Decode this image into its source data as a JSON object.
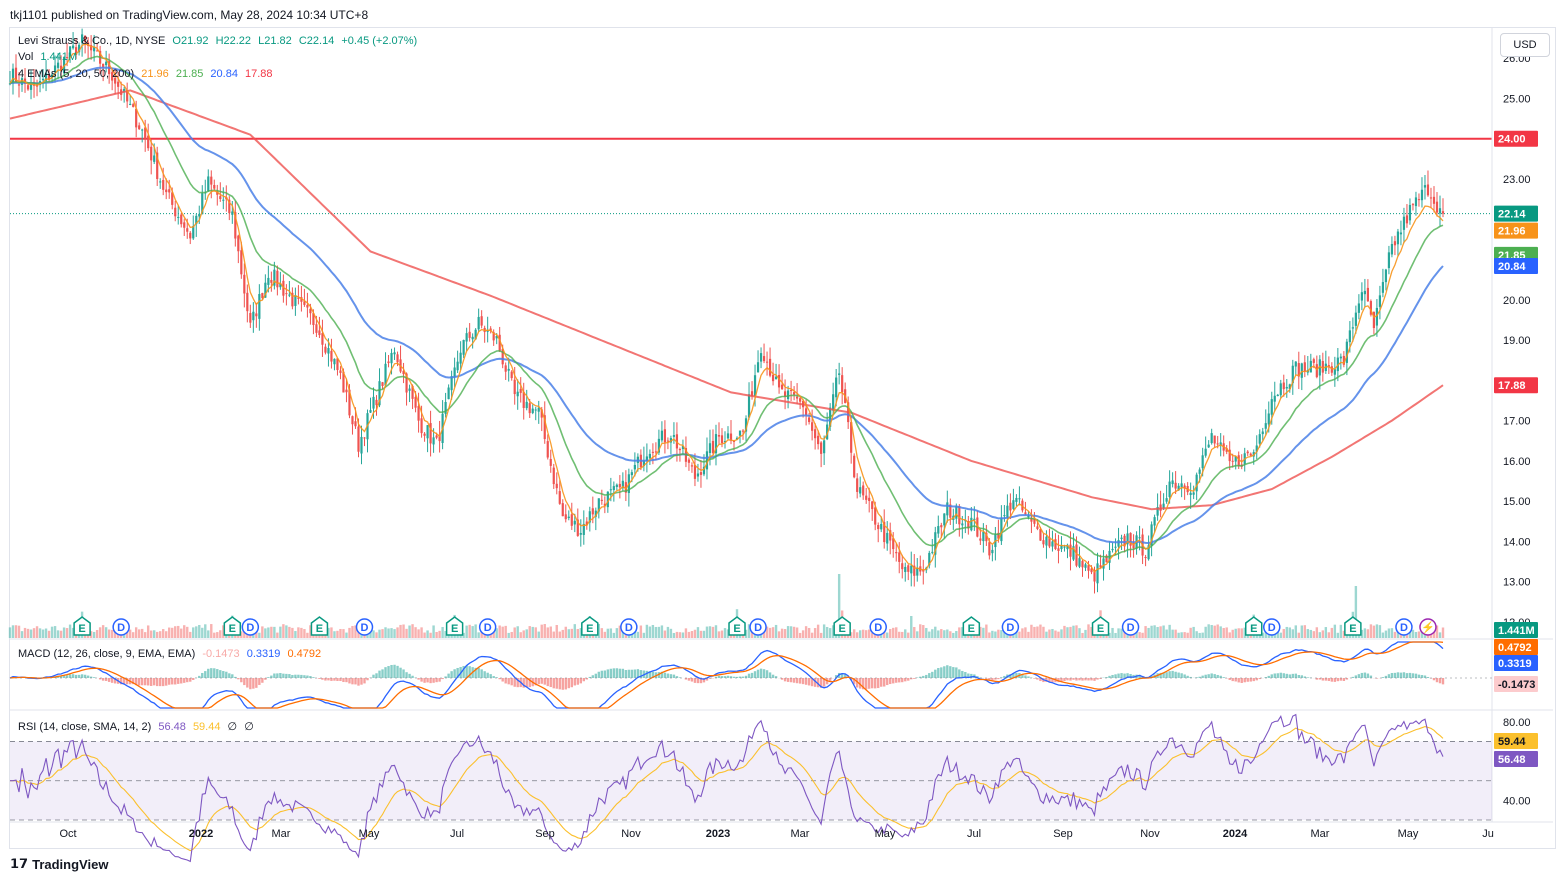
{
  "header": {
    "publisher": "tkj1101 published on TradingView.com, May 28, 2024 10:34 UTC+8"
  },
  "currency_button": "USD",
  "footer": {
    "brand": "TradingView"
  },
  "legend": {
    "symbol": "Levi Strauss & Co., 1D, NYSE",
    "ohlc": {
      "o": "O21.92",
      "h": "H22.22",
      "l": "L21.82",
      "c": "C22.14",
      "chg": "+0.45 (+2.07%)"
    },
    "vol_label": "Vol",
    "vol_value": "1.441M",
    "ema_label": "4 EMAs (5, 20, 50, 200)",
    "ema_values": [
      "21.96",
      "21.85",
      "20.84",
      "17.88"
    ],
    "macd_label": "MACD (12, 26, close, 9, EMA, EMA)",
    "macd_values": [
      "-0.1473",
      "0.3319",
      "0.4792"
    ],
    "rsi_label": "RSI (14, close, SMA, 14, 2)",
    "rsi_values": [
      "56.48",
      "59.44",
      "∅",
      "∅"
    ]
  },
  "colors": {
    "up": "#26a69a",
    "down": "#ef5350",
    "ema5": "#f7931a",
    "ema20": "#4caf50",
    "ema50": "#4a80e8",
    "ema200": "#ef5350",
    "hline": "#f23645",
    "macd": "#2962ff",
    "signal": "#ff6d00",
    "rsi": "#7e57c2",
    "rsi_ma": "#fbc02d"
  },
  "chart_data": [
    {
      "type": "candlestick",
      "title": "Levi Strauss & Co., 1D, NYSE",
      "ylim": [
        12.0,
        26.6
      ],
      "y_ticks": [
        "26.00",
        "25.00",
        "23.00",
        "20.00",
        "19.00",
        "17.00",
        "16.00",
        "15.00",
        "14.00",
        "13.00",
        "12.00"
      ],
      "x_ticks": [
        "Oct",
        "2022",
        "Mar",
        "May",
        "Jul",
        "Sep",
        "Nov",
        "2023",
        "Mar",
        "May",
        "Jul",
        "Sep",
        "Nov",
        "2024",
        "Mar",
        "May",
        "Ju"
      ],
      "horizontal_line": {
        "value": 24.0,
        "label": "24.00"
      },
      "last_price": 22.14,
      "price_labels": [
        {
          "label": "22.14",
          "value": 22.14,
          "color": "#089981"
        },
        {
          "label": "21.96",
          "value": 21.96,
          "color": "#f7931a"
        },
        {
          "label": "21.85",
          "value": 21.85,
          "color": "#4caf50"
        },
        {
          "label": "20.84",
          "value": 20.84,
          "color": "#2962ff"
        },
        {
          "label": "17.88",
          "value": 17.88,
          "color": "#f23645"
        }
      ],
      "close_series": [
        {
          "t": 0,
          "v": 25.6
        },
        {
          "t": 8,
          "v": 25.2
        },
        {
          "t": 16,
          "v": 25.8
        },
        {
          "t": 24,
          "v": 26.4
        },
        {
          "t": 34,
          "v": 25.6
        },
        {
          "t": 44,
          "v": 24.2
        },
        {
          "t": 52,
          "v": 22.6
        },
        {
          "t": 60,
          "v": 21.6
        },
        {
          "t": 66,
          "v": 22.9
        },
        {
          "t": 74,
          "v": 22.1
        },
        {
          "t": 80,
          "v": 19.3
        },
        {
          "t": 86,
          "v": 20.7
        },
        {
          "t": 94,
          "v": 20.0
        },
        {
          "t": 102,
          "v": 19.4
        },
        {
          "t": 110,
          "v": 18.1
        },
        {
          "t": 116,
          "v": 16.4
        },
        {
          "t": 122,
          "v": 17.6
        },
        {
          "t": 128,
          "v": 18.8
        },
        {
          "t": 136,
          "v": 17.0
        },
        {
          "t": 142,
          "v": 16.4
        },
        {
          "t": 150,
          "v": 18.8
        },
        {
          "t": 156,
          "v": 19.4
        },
        {
          "t": 162,
          "v": 19.0
        },
        {
          "t": 168,
          "v": 17.6
        },
        {
          "t": 176,
          "v": 17.2
        },
        {
          "t": 184,
          "v": 14.6
        },
        {
          "t": 190,
          "v": 14.3
        },
        {
          "t": 196,
          "v": 15.0
        },
        {
          "t": 204,
          "v": 15.3
        },
        {
          "t": 212,
          "v": 16.3
        },
        {
          "t": 220,
          "v": 16.7
        },
        {
          "t": 228,
          "v": 15.6
        },
        {
          "t": 236,
          "v": 16.6
        },
        {
          "t": 244,
          "v": 16.7
        },
        {
          "t": 250,
          "v": 18.9
        },
        {
          "t": 256,
          "v": 17.7
        },
        {
          "t": 264,
          "v": 17.4
        },
        {
          "t": 270,
          "v": 16.1
        },
        {
          "t": 276,
          "v": 18.2
        },
        {
          "t": 282,
          "v": 15.3
        },
        {
          "t": 290,
          "v": 14.3
        },
        {
          "t": 298,
          "v": 13.2
        },
        {
          "t": 304,
          "v": 13.3
        },
        {
          "t": 312,
          "v": 14.8
        },
        {
          "t": 320,
          "v": 14.5
        },
        {
          "t": 326,
          "v": 13.8
        },
        {
          "t": 334,
          "v": 15.1
        },
        {
          "t": 340,
          "v": 14.4
        },
        {
          "t": 346,
          "v": 14.0
        },
        {
          "t": 354,
          "v": 13.7
        },
        {
          "t": 360,
          "v": 13.1
        },
        {
          "t": 366,
          "v": 13.6
        },
        {
          "t": 372,
          "v": 14.1
        },
        {
          "t": 378,
          "v": 13.8
        },
        {
          "t": 386,
          "v": 15.5
        },
        {
          "t": 394,
          "v": 15.4
        },
        {
          "t": 400,
          "v": 16.6
        },
        {
          "t": 406,
          "v": 15.9
        },
        {
          "t": 414,
          "v": 16.2
        },
        {
          "t": 420,
          "v": 17.6
        },
        {
          "t": 428,
          "v": 18.3
        },
        {
          "t": 436,
          "v": 18.3
        },
        {
          "t": 444,
          "v": 18.5
        },
        {
          "t": 450,
          "v": 20.3
        },
        {
          "t": 454,
          "v": 19.3
        },
        {
          "t": 460,
          "v": 21.3
        },
        {
          "t": 466,
          "v": 22.2
        },
        {
          "t": 472,
          "v": 22.8
        },
        {
          "t": 477,
          "v": 22.1
        }
      ],
      "ema200_series": [
        {
          "t": 0,
          "v": 24.5
        },
        {
          "t": 40,
          "v": 25.2
        },
        {
          "t": 80,
          "v": 24.1
        },
        {
          "t": 120,
          "v": 21.2
        },
        {
          "t": 160,
          "v": 20.1
        },
        {
          "t": 200,
          "v": 18.9
        },
        {
          "t": 240,
          "v": 17.7
        },
        {
          "t": 280,
          "v": 17.2
        },
        {
          "t": 320,
          "v": 16.0
        },
        {
          "t": 360,
          "v": 15.1
        },
        {
          "t": 380,
          "v": 14.8
        },
        {
          "t": 400,
          "v": 14.9
        },
        {
          "t": 420,
          "v": 15.3
        },
        {
          "t": 440,
          "v": 16.1
        },
        {
          "t": 460,
          "v": 17.0
        },
        {
          "t": 477,
          "v": 17.88
        }
      ],
      "markers": [
        {
          "t": 24,
          "k": "E"
        },
        {
          "t": 37,
          "k": "D"
        },
        {
          "t": 74,
          "k": "E"
        },
        {
          "t": 80,
          "k": "D"
        },
        {
          "t": 103,
          "k": "E"
        },
        {
          "t": 118,
          "k": "D"
        },
        {
          "t": 148,
          "k": "E"
        },
        {
          "t": 159,
          "k": "D"
        },
        {
          "t": 193,
          "k": "E"
        },
        {
          "t": 206,
          "k": "D"
        },
        {
          "t": 242,
          "k": "E"
        },
        {
          "t": 249,
          "k": "D"
        },
        {
          "t": 277,
          "k": "E"
        },
        {
          "t": 289,
          "k": "D"
        },
        {
          "t": 320,
          "k": "E"
        },
        {
          "t": 333,
          "k": "D"
        },
        {
          "t": 363,
          "k": "E"
        },
        {
          "t": 373,
          "k": "D"
        },
        {
          "t": 414,
          "k": "E"
        },
        {
          "t": 420,
          "k": "D"
        },
        {
          "t": 447,
          "k": "E"
        },
        {
          "t": 464,
          "k": "D"
        },
        {
          "t": 472,
          "k": "⚡"
        }
      ]
    },
    {
      "type": "line",
      "title": "MACD (12, 26, close, 9, EMA, EMA)",
      "price_labels": [
        {
          "label": "0.4792",
          "color": "#ff6d00"
        },
        {
          "label": "0.3319",
          "color": "#2962ff"
        },
        {
          "label": "-0.1473",
          "color": "#fccbcd"
        }
      ]
    },
    {
      "type": "line",
      "title": "RSI (14, close, SMA, 14, 2)",
      "ylim": [
        30,
        85
      ],
      "y_ticks": [
        "80.00",
        "40.00"
      ],
      "bands": [
        70,
        50,
        30
      ],
      "price_labels": [
        {
          "label": "59.44",
          "value": 59.44,
          "color": "#fbc02d"
        },
        {
          "label": "56.48",
          "value": 56.48,
          "color": "#7e57c2"
        }
      ]
    }
  ]
}
